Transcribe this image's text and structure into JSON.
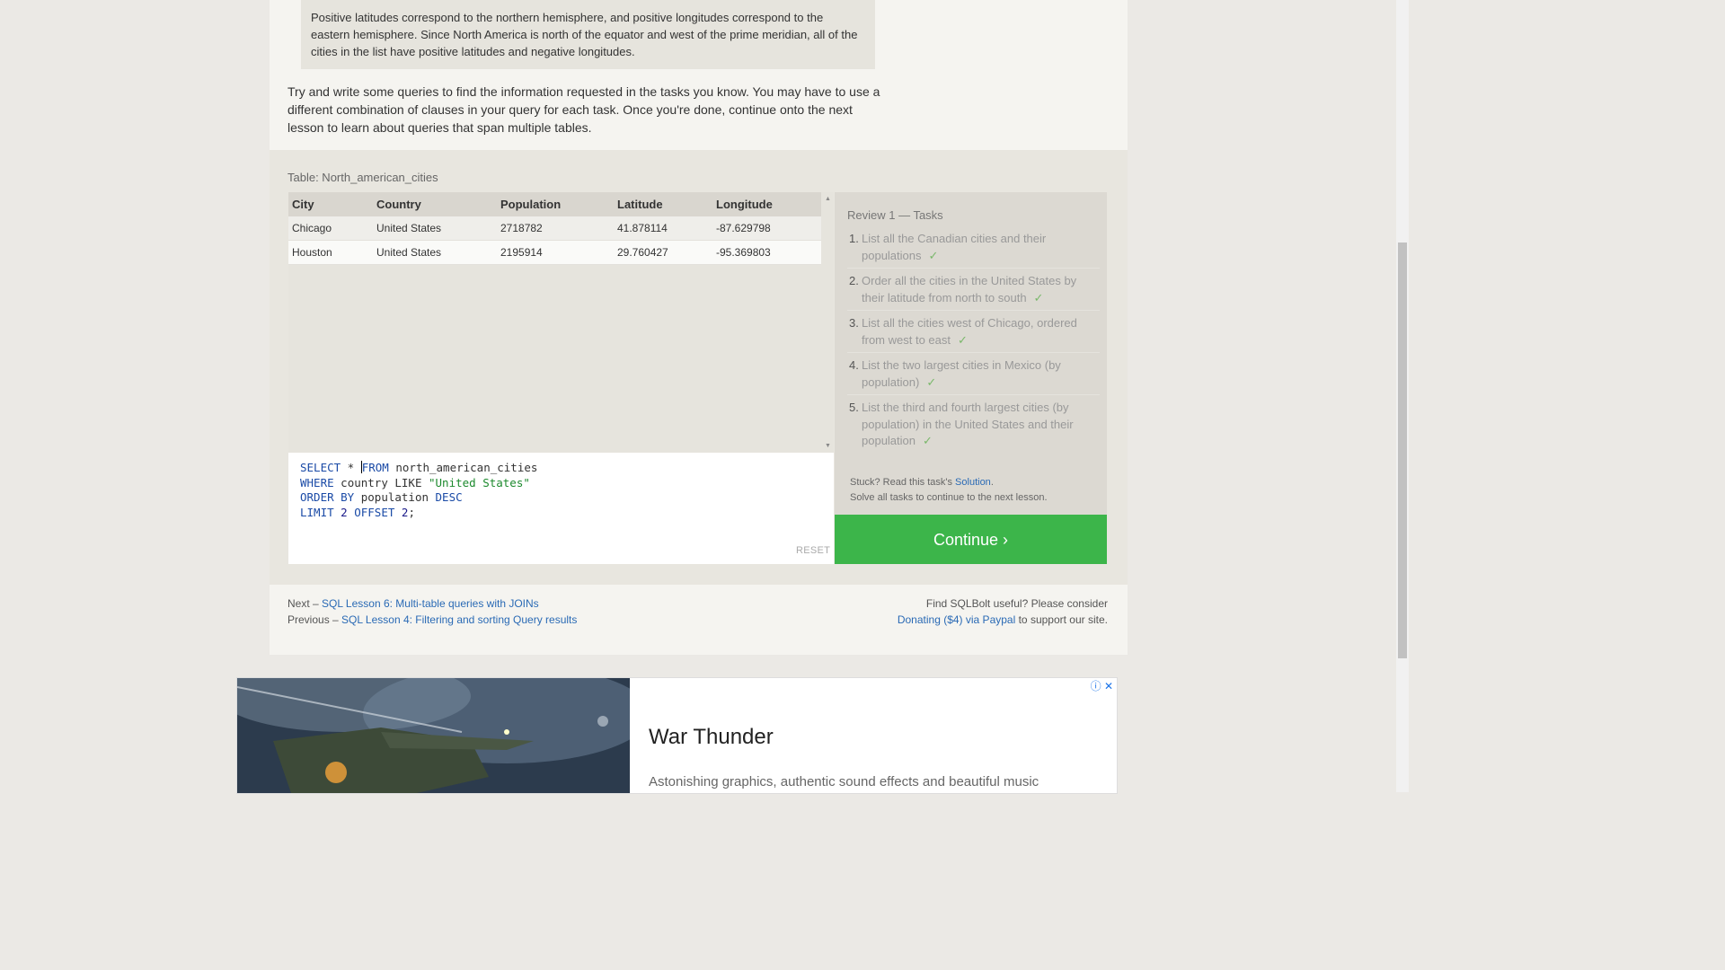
{
  "note": {
    "text": "Positive latitudes correspond to the northern hemisphere, and positive longitudes correspond to the eastern hemisphere. Since North America is north of the equator and west of the prime meridian, all of the cities in the list have positive latitudes and negative longitudes."
  },
  "intro": {
    "text": "Try and write some queries to find the information requested in the tasks you know. You may have to use a different combination of clauses in your query for each task. Once you're done, continue onto the next lesson to learn about queries that span multiple tables."
  },
  "table": {
    "caption": "Table: North_american_cities",
    "columns": [
      "City",
      "Country",
      "Population",
      "Latitude",
      "Longitude"
    ],
    "rows": [
      [
        "Chicago",
        "United States",
        "2718782",
        "41.878114",
        "-87.629798"
      ],
      [
        "Houston",
        "United States",
        "2195914",
        "29.760427",
        "-95.369803"
      ]
    ]
  },
  "editor": {
    "lines": [
      "SELECT * FROM north_american_cities",
      "WHERE country LIKE \"United States\"",
      "ORDER BY population DESC",
      "LIMIT 2 OFFSET 2;"
    ],
    "reset_label": "RESET"
  },
  "tasks": {
    "title": "Review 1 — Tasks",
    "items": [
      {
        "num": "1.",
        "text": "List all the Canadian cities and their populations",
        "check": "✓"
      },
      {
        "num": "2.",
        "text": "Order all the cities in the United States by their latitude from north to south",
        "check": "✓"
      },
      {
        "num": "3.",
        "text": "List all the cities west of Chicago, ordered from west to east",
        "check": "✓"
      },
      {
        "num": "4.",
        "text": "List the two largest cities in Mexico (by population)",
        "check": "✓"
      },
      {
        "num": "5.",
        "text": "List the third and fourth largest cities (by population) in the United States and their population",
        "check": "✓"
      }
    ],
    "stuck_prefix": "Stuck? Read this task's ",
    "solution_label": "Solution",
    "stuck_suffix": ".",
    "solve_all": "Solve all tasks to continue to the next lesson.",
    "continue_label": "Continue ›"
  },
  "footer": {
    "next_prefix": "Next – ",
    "next_link": "SQL Lesson 6: Multi-table queries with JOINs",
    "prev_prefix": "Previous – ",
    "prev_link": "SQL Lesson 4: Filtering and sorting Query results",
    "donate_text": "Find SQLBolt useful? Please consider",
    "donate_link": "Donating ($4) via Paypal",
    "donate_suffix": " to support our site."
  },
  "ad": {
    "title": "War Thunder",
    "description": "Astonishing graphics, authentic sound effects and beautiful music",
    "info_icon": "info-icon",
    "close_icon": "close-icon"
  },
  "colors": {
    "continue": "#3cb54a",
    "link": "#2a6ab5",
    "check": "#7ab86b"
  }
}
